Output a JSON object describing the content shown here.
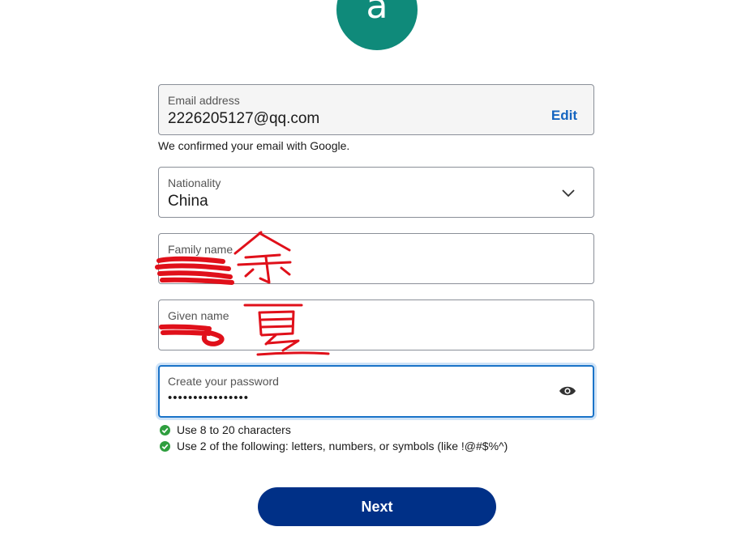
{
  "avatar": {
    "letter": "a",
    "color": "#0f8a7a"
  },
  "email": {
    "label": "Email address",
    "value": "2226205127@qq.com",
    "edit_label": "Edit",
    "confirmation": "We confirmed your email with Google."
  },
  "nationality": {
    "label": "Nationality",
    "value": "China",
    "icon": "chevron-down-icon"
  },
  "family_name": {
    "label": "Family name",
    "handwritten_annotation": "余"
  },
  "given_name": {
    "label": "Given name",
    "handwritten_annotation": "夏"
  },
  "password": {
    "label": "Create your password",
    "masked_value": "••••••••••••••••",
    "icon": "eye-icon"
  },
  "password_rules": [
    {
      "text": "Use 8 to 20 characters",
      "status": "satisfied"
    },
    {
      "text": "Use 2 of the following: letters, numbers, or symbols (like !@#$%^)",
      "status": "satisfied"
    }
  ],
  "next_button": {
    "label": "Next",
    "color": "#003087"
  },
  "colors": {
    "link": "#1565c0",
    "check": "#2e9e3e",
    "focus": "#1a73c8",
    "annotation": "#e0101a"
  }
}
